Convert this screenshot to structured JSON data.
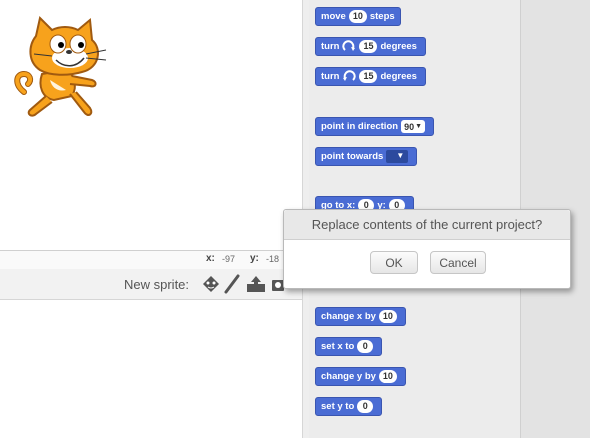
{
  "stage": {
    "sprite": "cat-sprite"
  },
  "info_bar": {
    "x_label": "x:",
    "x_value": "-97",
    "y_label": "y:",
    "y_value": "-18"
  },
  "sprite_bar": {
    "new_sprite_label": "New sprite:"
  },
  "palette": {
    "blocks": [
      {
        "text1": "move",
        "value": "10",
        "text2": "steps"
      },
      {
        "text1": "turn",
        "value": "15",
        "text2": "degrees",
        "icon": "rotate-cw-icon"
      },
      {
        "text1": "turn",
        "value": "15",
        "text2": "degrees",
        "icon": "rotate-ccw-icon"
      },
      {
        "text1": "point in direction",
        "value": "90"
      },
      {
        "text1": "point towards"
      },
      {
        "text1": "go to x:",
        "value": "0",
        "text2": "y:",
        "value2": "0"
      },
      {
        "text1": "change x by",
        "value": "10"
      },
      {
        "text1": "set x to",
        "value": "0"
      },
      {
        "text1": "change y by",
        "value": "10"
      },
      {
        "text1": "set y to",
        "value": "0"
      }
    ]
  },
  "dialog": {
    "title": "Replace contents of the current project?",
    "ok_label": "OK",
    "cancel_label": "Cancel"
  },
  "colors": {
    "motion_block": "#4a6cd4",
    "cat_orange": "#f7a21c"
  }
}
